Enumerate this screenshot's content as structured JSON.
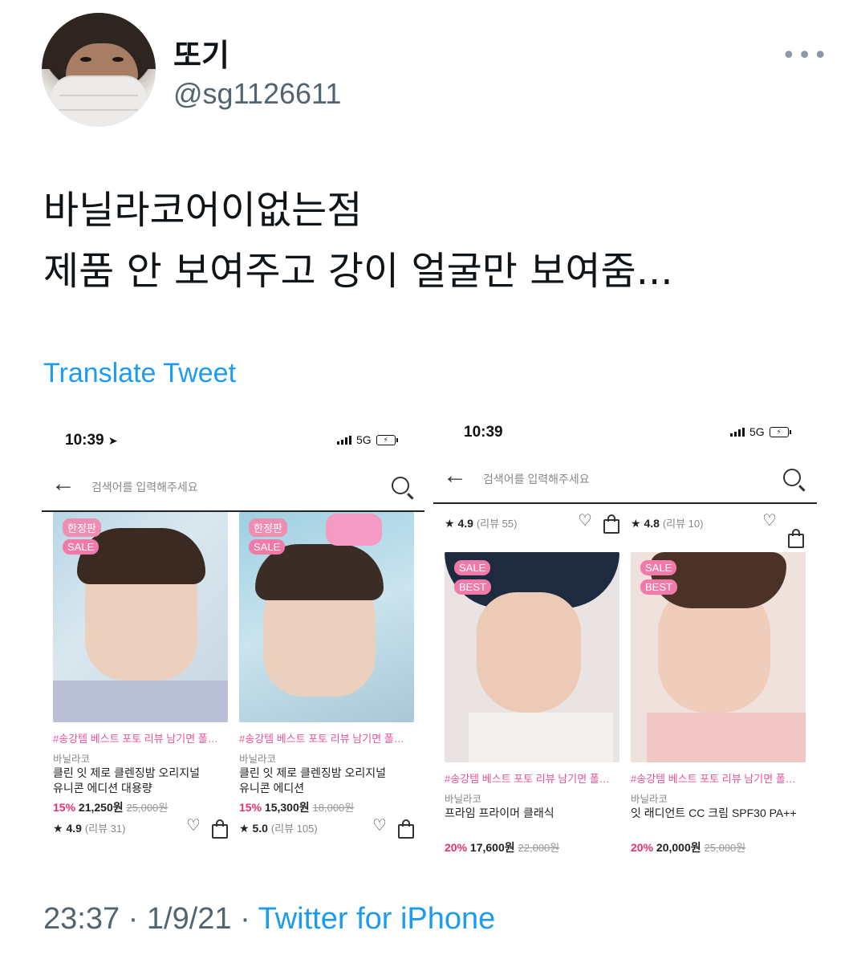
{
  "tweet": {
    "display_name": "또기",
    "handle": "@sg1126611",
    "more_icon": "more-horizontal-icon",
    "text_line1": "바닐라코어이없는점",
    "text_line2": "제품 안 보여주고 강이 얼굴만 보여줌...",
    "translate_label": "Translate Tweet",
    "time": "23:37",
    "date": "1/9/21",
    "separator": "·",
    "source": "Twitter for iPhone"
  },
  "screenshot_left": {
    "status_time": "10:39",
    "network": "5G",
    "search_placeholder": "검색어를 입력해주세요",
    "products": [
      {
        "badges": [
          "한정판",
          "SALE"
        ],
        "tag": "#송강템 베스트 포토 리뷰 남기면 폴…",
        "brand": "바닐라코",
        "name_line1": "클린 잇 제로 클렌징밤 오리지널",
        "name_line2": "유니콘 에디션 대용량",
        "discount": "15%",
        "price": "21,250원",
        "original_price": "25,000원",
        "star": "★",
        "rating": "4.9",
        "reviews": "(리뷰 31)"
      },
      {
        "badges": [
          "한정판",
          "SALE"
        ],
        "tag": "#송강템 베스트 포토 리뷰 남기면 폴…",
        "brand": "바닐라코",
        "name_line1": "클린 잇 제로 클렌징밤 오리지널",
        "name_line2": "유니콘 에디션",
        "discount": "15%",
        "price": "15,300원",
        "original_price": "18,000원",
        "star": "★",
        "rating": "5.0",
        "reviews": "(리뷰 105)"
      }
    ]
  },
  "screenshot_right": {
    "status_time": "10:39",
    "network": "5G",
    "search_placeholder": "검색어를 입력해주세요",
    "top_row": [
      {
        "star": "★",
        "rating": "4.9",
        "reviews": "(리뷰 55)"
      },
      {
        "star": "★",
        "rating": "4.8",
        "reviews": "(리뷰 10)"
      }
    ],
    "products": [
      {
        "badges": [
          "SALE",
          "BEST"
        ],
        "tag": "#송강템 베스트 포토 리뷰 남기면 폴…",
        "brand": "바닐라코",
        "name_line1": "프라임 프라이머 클래식",
        "discount": "20%",
        "price": "17,600원",
        "original_price": "22,000원"
      },
      {
        "badges": [
          "SALE",
          "BEST"
        ],
        "tag": "#송강템 베스트 포토 리뷰 남기면 폴…",
        "brand": "바닐라코",
        "name_line1": "잇 래디언트 CC 크림 SPF30 PA++",
        "discount": "20%",
        "price": "20,000원",
        "original_price": "25,000원"
      }
    ]
  },
  "colors": {
    "link_blue": "#1d9bf0",
    "secondary_gray": "#536471",
    "tag_pink": "#e8539a",
    "discount_red": "#e8336f"
  }
}
